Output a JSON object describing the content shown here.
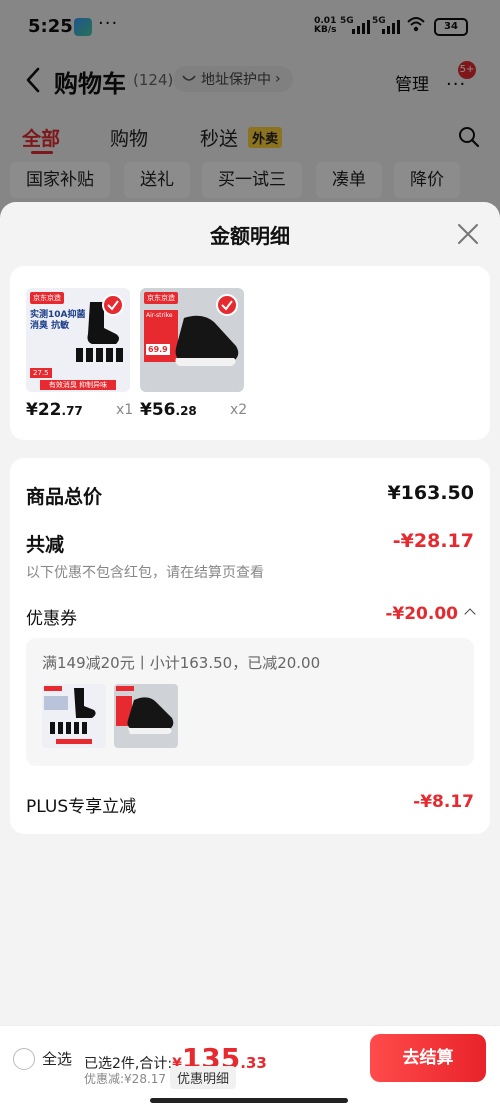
{
  "status": {
    "time": "5:25",
    "dots": "···",
    "speed_value": "0.01",
    "speed_unit": "KB/s",
    "network1": "5G",
    "network2": "5G",
    "battery": "34"
  },
  "nav": {
    "title": "购物车",
    "count": "(124)",
    "address_protect": "地址保护中",
    "manage": "管理",
    "more": "···",
    "badge": "5+"
  },
  "tabs": [
    {
      "label": "全部"
    },
    {
      "label": "购物"
    },
    {
      "label": "秒送"
    }
  ],
  "takeout_badge": "外卖",
  "chips": [
    {
      "label": "国家补贴"
    },
    {
      "label": "送礼"
    },
    {
      "label": "买一试三"
    },
    {
      "label": "凑单"
    },
    {
      "label": "降价"
    }
  ],
  "sheet": {
    "title": "金额明细",
    "products": [
      {
        "price_symbol": "¥",
        "price_int": "22",
        "price_dec": ".77",
        "qty": "x1",
        "tag": "京东京造",
        "line1": "实测10A抑菌",
        "line2": "消臭 抗敏",
        "price_tag": "27.5",
        "footer": "有效消臭 抑制异味",
        "img_bg": "#eef0f5"
      },
      {
        "price_symbol": "¥",
        "price_int": "56",
        "price_dec": ".28",
        "qty": "x2",
        "tag": "京东京造",
        "line1": "Air-strike",
        "line2": "",
        "price_tag": "69.9",
        "footer": "",
        "img_bg": "#cfd2d6"
      }
    ],
    "total_label": "商品总价",
    "total_value": "¥163.50",
    "reduce_label": "共减",
    "reduce_value": "-¥28.17",
    "reduce_note": "以下优惠不包含红包，请在结算页查看",
    "coupon_label": "优惠券",
    "coupon_value": "-¥20.00",
    "coupon_desc": "满149减20元丨小计163.50，已减20.00",
    "plus_label": "PLUS专享立减",
    "plus_value": "-¥8.17"
  },
  "bottom": {
    "select_all": "全选",
    "selected_text": "已选2件,合计:",
    "total_yen": "¥",
    "total_int": "135",
    "total_dec": ".33",
    "discount_text": "优惠减:¥28.17",
    "detail_btn": "优惠明细",
    "checkout": "去结算"
  },
  "colors": {
    "accent": "#e62a2f",
    "takeout_badge_bg": "#ffd23a"
  }
}
